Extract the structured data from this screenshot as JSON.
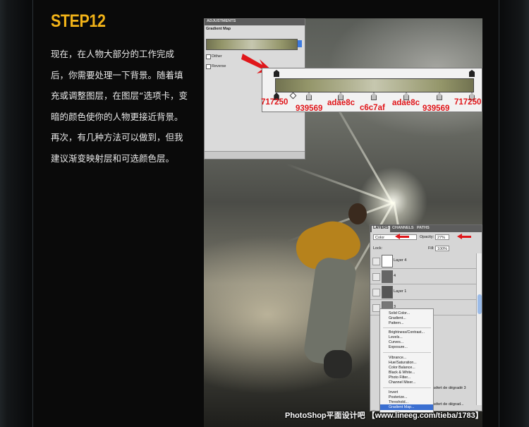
{
  "step": {
    "title": "STEP12"
  },
  "instructions": "现在，在人物大部分的工作完成后，你需要处理一下背景。随着填充或调整图层，在图层“选项卡，变暗的颜色使你的人物更接近背景。再次，有几种方法可以做到，但我建议渐变映射层和可选颜色层。",
  "adjustments": {
    "tab": "ADJUSTMENTS",
    "subtitle": "Gradient Map",
    "options": [
      {
        "label": "Dither"
      },
      {
        "label": "Reverse"
      }
    ]
  },
  "gradient": {
    "colors": [
      "#717250",
      "#939569",
      "#adae8c",
      "#c6c7af",
      "#adae8c",
      "#939569",
      "#717250"
    ],
    "stop_labels": [
      "717250",
      "939569",
      "adae8c",
      "c6c7af",
      "adae8c",
      "939569",
      "717250"
    ]
  },
  "layers_panel": {
    "tabs": [
      "LAYERS",
      "CHANNELS",
      "PATHS"
    ],
    "blend_mode": "Color",
    "opacity_label": "Opacity:",
    "opacity": "27%",
    "lock_label": "Lock:",
    "fill_label": "Fill:",
    "fill": "100%",
    "layers": [
      "Layer 4",
      "4",
      "Layer 1",
      "3"
    ],
    "side_texts": [
      "ransfert de dégradé 3",
      "ransfert de dégrad..."
    ]
  },
  "menu": {
    "items": [
      "Solid Color...",
      "Gradient...",
      "Pattern...",
      "Brightness/Contrast...",
      "Levels...",
      "Curves...",
      "Exposure...",
      "Vibrance...",
      "Hue/Saturation...",
      "Color Balance...",
      "Black & White...",
      "Photo Filter...",
      "Channel Mixer...",
      "Invert",
      "Posterize...",
      "Threshold...",
      "Gradient Map..."
    ],
    "highlighted": "Gradient Map..."
  },
  "watermark": "PhotoShop平面设计吧 【www.lineeg.com/tieba/1783】",
  "colors": {
    "title": "#f2b318",
    "annotation": "#e0161a",
    "text": "#e9e9e9"
  }
}
